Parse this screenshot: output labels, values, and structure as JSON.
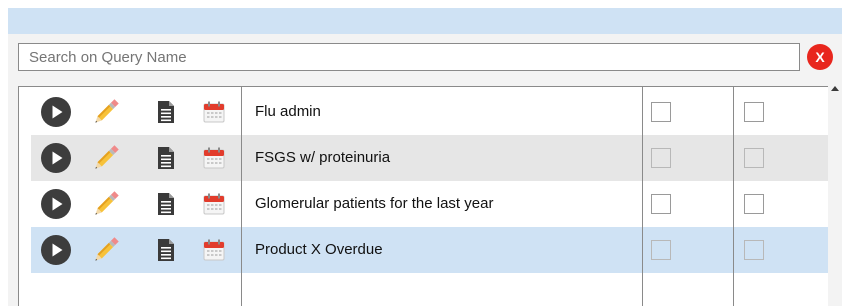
{
  "search": {
    "placeholder": "Search on Query Name",
    "value": ""
  },
  "clear_button": {
    "label": "X",
    "color": "#e8261d"
  },
  "colors": {
    "header_bar": "#cfe2f4",
    "row_shaded": "#e6e6e6",
    "row_selected": "#cfe2f4"
  },
  "icons": [
    "play-icon",
    "pencil-icon",
    "document-icon",
    "calendar-icon"
  ],
  "queries": [
    {
      "name": "Flu admin",
      "state": "normal",
      "check1": false,
      "check2": false
    },
    {
      "name": "FSGS w/ proteinuria",
      "state": "shaded",
      "check1": false,
      "check2": false
    },
    {
      "name": "Glomerular patients for the last year",
      "state": "normal",
      "check1": false,
      "check2": false
    },
    {
      "name": "Product X Overdue",
      "state": "selected",
      "check1": false,
      "check2": false
    }
  ]
}
